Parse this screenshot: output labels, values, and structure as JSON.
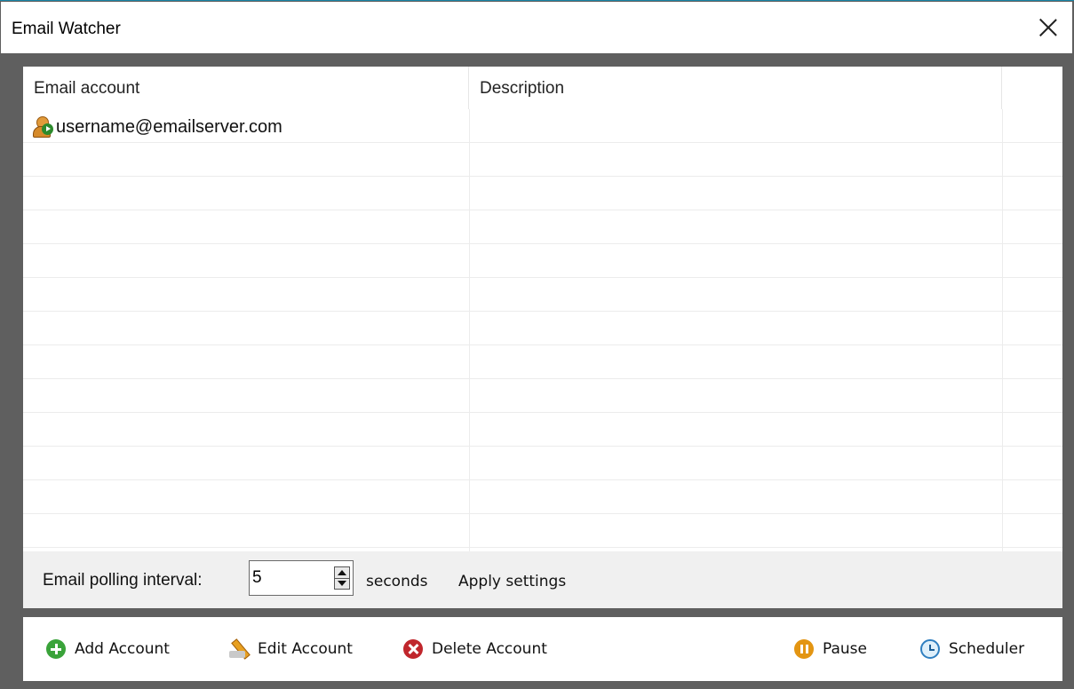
{
  "window": {
    "title": "Email Watcher"
  },
  "list": {
    "columns": [
      {
        "label": "Email account"
      },
      {
        "label": "Description"
      },
      {
        "label": ""
      }
    ],
    "rows": [
      {
        "account": "username@emailserver.com",
        "description": "",
        "icon": "account-active-icon"
      }
    ]
  },
  "settings": {
    "polling_label": "Email polling interval:",
    "polling_value": "5",
    "unit": "seconds",
    "apply_label": "Apply settings"
  },
  "toolbar": {
    "add_label": "Add Account",
    "edit_label": "Edit Account",
    "delete_label": "Delete Account",
    "pause_label": "Pause",
    "scheduler_label": "Scheduler"
  },
  "colors": {
    "frame": "#5f5f5f",
    "accent_border": "#1a86a8",
    "add": "#3aa33a",
    "delete": "#c0262c",
    "pause": "#e39512",
    "scheduler": "#2f7fc0"
  }
}
